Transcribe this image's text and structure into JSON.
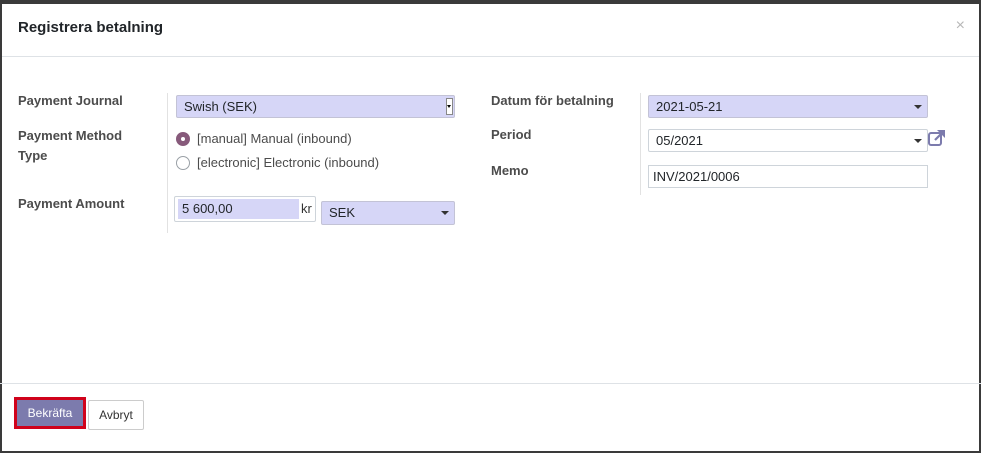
{
  "dialog": {
    "title": "Registrera betalning",
    "close_label": "×"
  },
  "left": {
    "journal_label": "Payment Journal",
    "journal_value": "Swish (SEK)",
    "method_label_line1": "Payment Method",
    "method_label_line2": "Type",
    "methods": [
      {
        "label": "[manual] Manual (inbound)",
        "selected": true
      },
      {
        "label": "[electronic] Electronic (inbound)",
        "selected": false
      }
    ],
    "amount_label": "Payment Amount",
    "amount_value": "5 600,00",
    "currency_symbol": "kr",
    "currency_value": "SEK"
  },
  "right": {
    "date_label": "Datum för betalning",
    "date_value": "2021-05-21",
    "period_label": "Period",
    "period_value": "05/2021",
    "memo_label": "Memo",
    "memo_value": "INV/2021/0006"
  },
  "footer": {
    "confirm_label": "Bekräfta",
    "cancel_label": "Avbryt"
  },
  "colors": {
    "accent": "#875a7b",
    "primary_button": "#7c7bad",
    "field_highlight": "#d6d6f7",
    "highlight_border": "#d0021b"
  },
  "icons": {
    "external_link": "external-link-icon",
    "close": "close-icon"
  }
}
